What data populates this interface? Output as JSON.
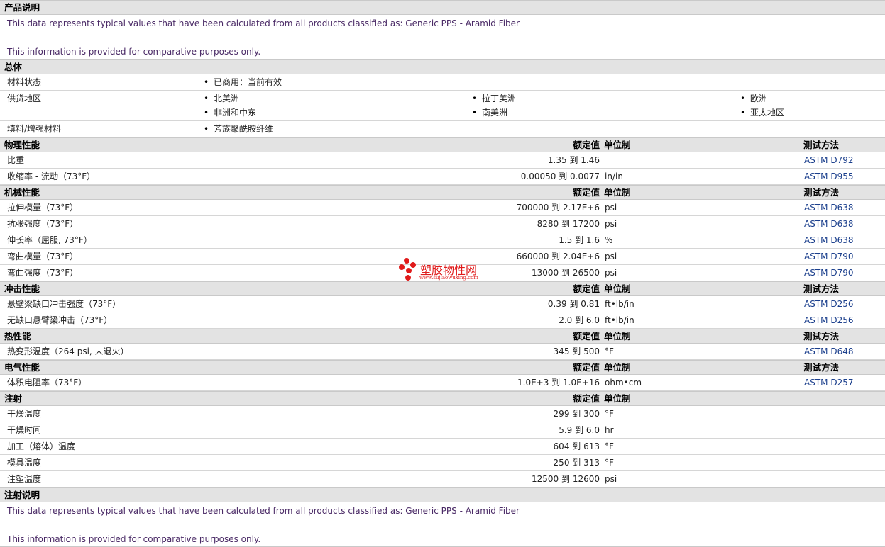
{
  "sections": {
    "description": {
      "title": "产品说明",
      "line1": "This data represents typical values that have been calculated from all products classified as: Generic PPS - Aramid Fiber",
      "line2": "This information is provided for comparative purposes only."
    },
    "general": {
      "title": "总体",
      "status_label": "材料状态",
      "status_value": "已商用：当前有效",
      "regions_label": "供货地区",
      "regions": [
        "北美洲",
        "拉丁美洲",
        "欧洲",
        "非洲和中东",
        "南美洲",
        "亚太地区"
      ],
      "filler_label": "填料/增强材料",
      "filler_value": "芳族聚酰胺纤维"
    },
    "columns": {
      "value": "额定值",
      "unit": "单位制",
      "method": "测试方法"
    },
    "physical": {
      "title": "物理性能",
      "rows": [
        {
          "name": "比重",
          "value": "1.35 到  1.46",
          "unit": "",
          "method": "ASTM D792"
        },
        {
          "name": "收缩率 - 流动（73°F）",
          "value": "0.00050 到  0.0077",
          "unit": "in/in",
          "method": "ASTM D955"
        }
      ]
    },
    "mechanical": {
      "title": "机械性能",
      "rows": [
        {
          "name": "拉伸模量（73°F）",
          "value": "700000 到  2.17E+6",
          "unit": "psi",
          "method": "ASTM D638"
        },
        {
          "name": "抗张强度（73°F）",
          "value": "8280 到  17200",
          "unit": "psi",
          "method": "ASTM D638"
        },
        {
          "name": "伸长率（屈服, 73°F）",
          "value": "1.5 到  1.6",
          "unit": "%",
          "method": "ASTM D638"
        },
        {
          "name": "弯曲模量（73°F）",
          "value": "660000 到  2.04E+6",
          "unit": "psi",
          "method": "ASTM D790"
        },
        {
          "name": "弯曲强度（73°F）",
          "value": "13000 到  26500",
          "unit": "psi",
          "method": "ASTM D790"
        }
      ]
    },
    "impact": {
      "title": "冲击性能",
      "rows": [
        {
          "name": "悬壁梁缺口冲击强度（73°F）",
          "value": "0.39 到  0.81",
          "unit": "ft•lb/in",
          "method": "ASTM D256"
        },
        {
          "name": "无缺口悬臂梁冲击（73°F）",
          "value": "2.0 到  6.0",
          "unit": "ft•lb/in",
          "method": "ASTM D256"
        }
      ]
    },
    "thermal": {
      "title": "热性能",
      "rows": [
        {
          "name": "热变形温度（264 psi, 未退火）",
          "value": "345 到  500",
          "unit": "°F",
          "method": "ASTM D648"
        }
      ]
    },
    "electrical": {
      "title": "电气性能",
      "rows": [
        {
          "name": "体积电阻率（73°F）",
          "value": "1.0E+3 到  1.0E+16",
          "unit": "ohm•cm",
          "method": "ASTM D257"
        }
      ]
    },
    "injection": {
      "title": "注射",
      "rows": [
        {
          "name": "干燥温度",
          "value": "299 到  300",
          "unit": "°F"
        },
        {
          "name": "干燥时间",
          "value": "5.9 到  6.0",
          "unit": "hr"
        },
        {
          "name": "加工（熔体）温度",
          "value": "604 到  613",
          "unit": "°F"
        },
        {
          "name": "模具温度",
          "value": "250 到  313",
          "unit": "°F"
        },
        {
          "name": "注塑温度",
          "value": "12500 到  12600",
          "unit": "psi"
        }
      ]
    },
    "injection_notes": {
      "title": "注射说明",
      "line1": "This data represents typical values that have been calculated from all products classified as: Generic PPS - Aramid Fiber",
      "line2": "This information is provided for comparative purposes only."
    }
  },
  "watermark": {
    "name": "塑胶物性网",
    "url": "www.sujiaowuxing.com",
    "color": "#e01a1a"
  }
}
